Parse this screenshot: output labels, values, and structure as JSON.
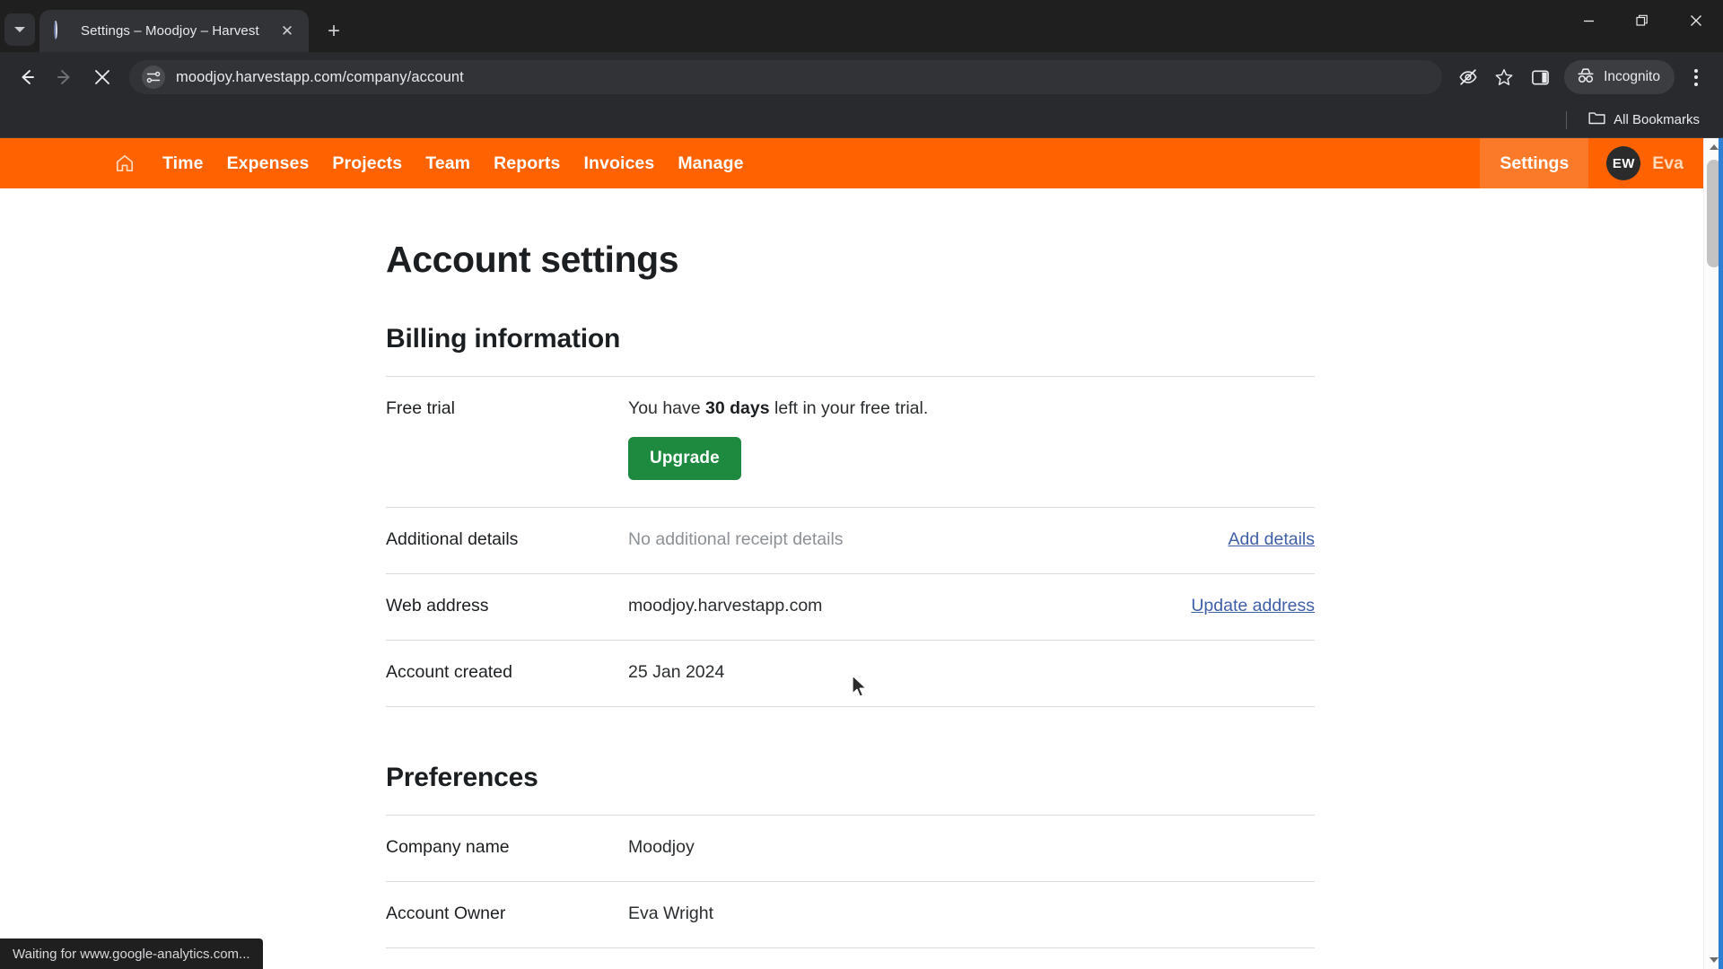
{
  "browser": {
    "tab": {
      "title": "Settings – Moodjoy – Harvest",
      "favicon": "loading-spinner-icon",
      "close_label": "✕"
    },
    "new_tab_label": "+",
    "tab_search_name": "tab-search-icon",
    "window_controls": {
      "minimize": "—",
      "maximize": "❐",
      "close": "✕"
    },
    "toolbar": {
      "back": "back-arrow-icon",
      "forward": "forward-arrow-icon",
      "stop": "stop-loading-icon",
      "site_info": "site-settings-icon",
      "url": "moodjoy.harvestapp.com/company/account",
      "url_placeholder": "Search Google or type a URL",
      "tracking_protection": "eye-slash-icon",
      "bookmark": "star-icon",
      "side_panel": "side-panel-icon",
      "incognito_label": "Incognito",
      "menu": "kebab-menu-icon"
    },
    "bookmarks": {
      "all_bookmarks_label": "All Bookmarks",
      "folder_icon": "folder-icon"
    },
    "status_text": "Waiting for www.google-analytics.com..."
  },
  "app": {
    "nav": {
      "home_icon": "home-icon",
      "items": [
        {
          "label": "Time"
        },
        {
          "label": "Expenses"
        },
        {
          "label": "Projects"
        },
        {
          "label": "Team"
        },
        {
          "label": "Reports"
        },
        {
          "label": "Invoices"
        },
        {
          "label": "Manage"
        }
      ],
      "settings_label": "Settings",
      "avatar_initials": "EW",
      "user_name": "Eva",
      "brand_color": "#ff6200",
      "active_color": "#fb7a2a"
    },
    "page_title": "Account settings",
    "sections": [
      {
        "id": "billing",
        "title": "Billing information",
        "rows": [
          {
            "label": "Free trial",
            "value_prefix": "You have ",
            "value_strong": "30 days",
            "value_suffix": " left in your free trial.",
            "button": "Upgrade",
            "button_color": "#1d8a3f"
          },
          {
            "label": "Additional details",
            "value": "No additional receipt details",
            "muted": true,
            "action": "Add details"
          },
          {
            "label": "Web address",
            "value": "moodjoy.harvestapp.com",
            "muted": false,
            "action": "Update address"
          },
          {
            "label": "Account created",
            "value": "25 Jan 2024",
            "muted": false,
            "action": ""
          }
        ]
      },
      {
        "id": "preferences",
        "title": "Preferences",
        "rows": [
          {
            "label": "Company name",
            "value": "Moodjoy",
            "muted": false,
            "action": ""
          },
          {
            "label": "Account Owner",
            "value": "Eva Wright",
            "muted": false,
            "action": ""
          }
        ]
      }
    ],
    "link_color": "#3f5fa8"
  }
}
